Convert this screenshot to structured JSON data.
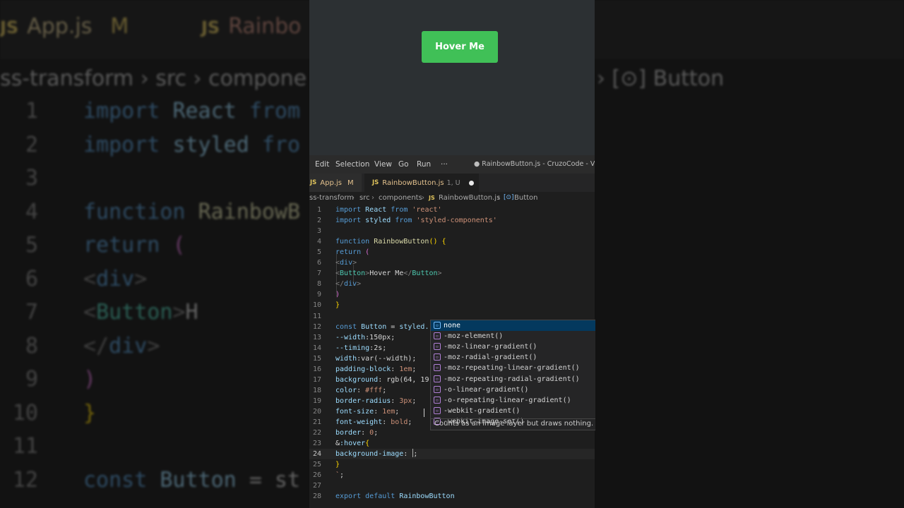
{
  "background_editor": {
    "tabs": [
      {
        "icon": "JS",
        "label": "App.js",
        "flag": "M"
      },
      {
        "icon": "JS",
        "label": "Rainbo"
      }
    ],
    "breadcrumb_left": "ss-transform › src › compone",
    "breadcrumb_right": "› [⊙] Button",
    "lines": [
      {
        "n": "1",
        "segs": [
          [
            "kw",
            "import "
          ],
          [
            "ident",
            "React "
          ],
          [
            "kw",
            "from"
          ]
        ]
      },
      {
        "n": "2",
        "segs": [
          [
            "kw",
            "import "
          ],
          [
            "ident",
            "styled "
          ],
          [
            "kw",
            "fro"
          ]
        ]
      },
      {
        "n": "3",
        "segs": []
      },
      {
        "n": "4",
        "segs": [
          [
            "kw",
            "function "
          ],
          [
            "fn",
            "RainbowB"
          ]
        ]
      },
      {
        "n": "5",
        "segs": [
          [
            "kw",
            "  return "
          ],
          [
            "paren",
            "("
          ]
        ]
      },
      {
        "n": "6",
        "segs": [
          [
            "tag",
            "    <"
          ],
          [
            "kw",
            "div"
          ],
          [
            "tag",
            ">"
          ]
        ]
      },
      {
        "n": "7",
        "segs": [
          [
            "tag",
            "        <"
          ],
          [
            "tagname",
            "Button"
          ],
          [
            "tag",
            ">"
          ],
          [
            "txt",
            "H"
          ]
        ]
      },
      {
        "n": "8",
        "segs": [
          [
            "tag",
            "    </"
          ],
          [
            "kw",
            "div"
          ],
          [
            "tag",
            ">"
          ]
        ]
      },
      {
        "n": "9",
        "segs": [
          [
            "paren",
            "  )"
          ]
        ]
      },
      {
        "n": "10",
        "segs": [
          [
            "brace",
            "}"
          ]
        ]
      },
      {
        "n": "11",
        "segs": []
      },
      {
        "n": "12",
        "segs": [
          [
            "kw",
            "const "
          ],
          [
            "ident",
            "Button "
          ],
          [
            "txt",
            "= st"
          ]
        ]
      }
    ]
  },
  "preview": {
    "button_label": "Hover Me",
    "button_color": "#40c057"
  },
  "menubar": {
    "items": [
      "Edit",
      "Selection",
      "View",
      "Go",
      "Run",
      "···"
    ],
    "window_title": "● RainbowButton.js - CruzoCode - Visual"
  },
  "tabs": {
    "inactive": {
      "icon": "JS",
      "label": "App.js",
      "flag": "M"
    },
    "active": {
      "icon": "JS",
      "label": "RainbowButton.js",
      "flag": "1, U"
    }
  },
  "breadcrumb": {
    "parts": [
      "ss-transform",
      "src",
      "components",
      "RainbowButton.js",
      "Button"
    ],
    "js_icon": "JS",
    "symbol_icon": "[⊙]"
  },
  "editor": {
    "current_line": "24",
    "lines": [
      {
        "n": "1",
        "segs": [
          [
            "kw",
            "import "
          ],
          [
            "ident",
            "React "
          ],
          [
            "kw",
            "from "
          ],
          [
            "str",
            "'react'"
          ]
        ]
      },
      {
        "n": "2",
        "segs": [
          [
            "kw",
            "import "
          ],
          [
            "ident",
            "styled "
          ],
          [
            "kw",
            "from "
          ],
          [
            "str",
            "'styled-components'"
          ]
        ]
      },
      {
        "n": "3",
        "segs": []
      },
      {
        "n": "4",
        "segs": [
          [
            "kw",
            "function "
          ],
          [
            "fn",
            "RainbowButton"
          ],
          [
            "brace",
            "() {"
          ]
        ]
      },
      {
        "n": "5",
        "segs": [
          [
            "kw",
            "  return "
          ],
          [
            "paren",
            "("
          ]
        ]
      },
      {
        "n": "6",
        "segs": [
          [
            "tag",
            "    <"
          ],
          [
            "kw",
            "div"
          ],
          [
            "tag",
            ">"
          ]
        ]
      },
      {
        "n": "7",
        "segs": [
          [
            "tag",
            "        <"
          ],
          [
            "tagname",
            "Button"
          ],
          [
            "tag",
            ">"
          ],
          [
            "txt",
            "Hover Me"
          ],
          [
            "tag",
            "</"
          ],
          [
            "tagname",
            "Button"
          ],
          [
            "tag",
            ">"
          ]
        ]
      },
      {
        "n": "8",
        "segs": [
          [
            "tag",
            "    </"
          ],
          [
            "kw",
            "div"
          ],
          [
            "tag",
            ">"
          ]
        ]
      },
      {
        "n": "9",
        "segs": [
          [
            "paren",
            "  )"
          ]
        ]
      },
      {
        "n": "10",
        "segs": [
          [
            "brace",
            "}"
          ]
        ]
      },
      {
        "n": "11",
        "segs": []
      },
      {
        "n": "12",
        "segs": [
          [
            "kw",
            "const "
          ],
          [
            "ident",
            "Button "
          ],
          [
            "txt",
            "= "
          ],
          [
            "ident",
            "styled."
          ]
        ]
      },
      {
        "n": "13",
        "segs": [
          [
            "ident",
            "--width"
          ],
          [
            "txt",
            ":150px;"
          ]
        ]
      },
      {
        "n": "14",
        "segs": [
          [
            "ident",
            "--timing"
          ],
          [
            "txt",
            ":2s;"
          ]
        ]
      },
      {
        "n": "15",
        "segs": [
          [
            "ident",
            "width"
          ],
          [
            "txt",
            ":var(--width);"
          ]
        ]
      },
      {
        "n": "16",
        "segs": [
          [
            "ident",
            "padding-block"
          ],
          [
            "txt",
            ": "
          ],
          [
            "str",
            "1em"
          ],
          [
            "txt",
            ";"
          ]
        ]
      },
      {
        "n": "17",
        "segs": [
          [
            "ident",
            "background"
          ],
          [
            "txt",
            ": rgb(64, 19"
          ]
        ]
      },
      {
        "n": "18",
        "segs": [
          [
            "ident",
            "color"
          ],
          [
            "txt",
            ": "
          ],
          [
            "str",
            "#fff"
          ],
          [
            "txt",
            ";"
          ]
        ]
      },
      {
        "n": "19",
        "segs": [
          [
            "ident",
            "border-radius"
          ],
          [
            "txt",
            ": "
          ],
          [
            "str",
            "3px"
          ],
          [
            "txt",
            ";"
          ]
        ]
      },
      {
        "n": "20",
        "segs": [
          [
            "ident",
            "font-size"
          ],
          [
            "txt",
            ": "
          ],
          [
            "str",
            "1em"
          ],
          [
            "txt",
            ";"
          ]
        ]
      },
      {
        "n": "21",
        "segs": [
          [
            "ident",
            "font-weight"
          ],
          [
            "txt",
            ": "
          ],
          [
            "str",
            "bold"
          ],
          [
            "txt",
            ";"
          ]
        ]
      },
      {
        "n": "22",
        "segs": [
          [
            "ident",
            "border"
          ],
          [
            "txt",
            ": "
          ],
          [
            "str",
            "0"
          ],
          [
            "txt",
            ";"
          ]
        ]
      },
      {
        "n": "23",
        "segs": [
          [
            "txt",
            "&"
          ],
          [
            "ident",
            ":hover"
          ],
          [
            "brace",
            "{"
          ]
        ]
      },
      {
        "n": "24",
        "segs": [
          [
            "ident",
            "    background-image"
          ],
          [
            "txt",
            ": "
          ]
        ],
        "cursor": true,
        "trail": ";"
      },
      {
        "n": "25",
        "segs": [
          [
            "brace",
            "}"
          ]
        ]
      },
      {
        "n": "26",
        "segs": [
          [
            "str",
            "`"
          ],
          [
            "txt",
            ";"
          ]
        ]
      },
      {
        "n": "27",
        "segs": []
      },
      {
        "n": "28",
        "segs": [
          [
            "kw",
            "export "
          ],
          [
            "kw",
            "default "
          ],
          [
            "ident",
            "RainbowButton"
          ]
        ]
      }
    ]
  },
  "suggest": {
    "items": [
      {
        "label": "none",
        "icon": "value-icon"
      },
      {
        "label": "-moz-element()",
        "icon": "function-icon"
      },
      {
        "label": "-moz-linear-gradient()",
        "icon": "function-icon"
      },
      {
        "label": "-moz-radial-gradient()",
        "icon": "function-icon"
      },
      {
        "label": "-moz-repeating-linear-gradient()",
        "icon": "function-icon"
      },
      {
        "label": "-moz-repeating-radial-gradient()",
        "icon": "function-icon"
      },
      {
        "label": "-o-linear-gradient()",
        "icon": "function-icon"
      },
      {
        "label": "-o-repeating-linear-gradient()",
        "icon": "function-icon"
      },
      {
        "label": "-webkit-gradient()",
        "icon": "function-icon"
      },
      {
        "label": "-webkit-image-set()",
        "icon": "function-icon"
      }
    ],
    "selected_index": 0,
    "detail": "Counts as an image layer but draws nothing."
  }
}
